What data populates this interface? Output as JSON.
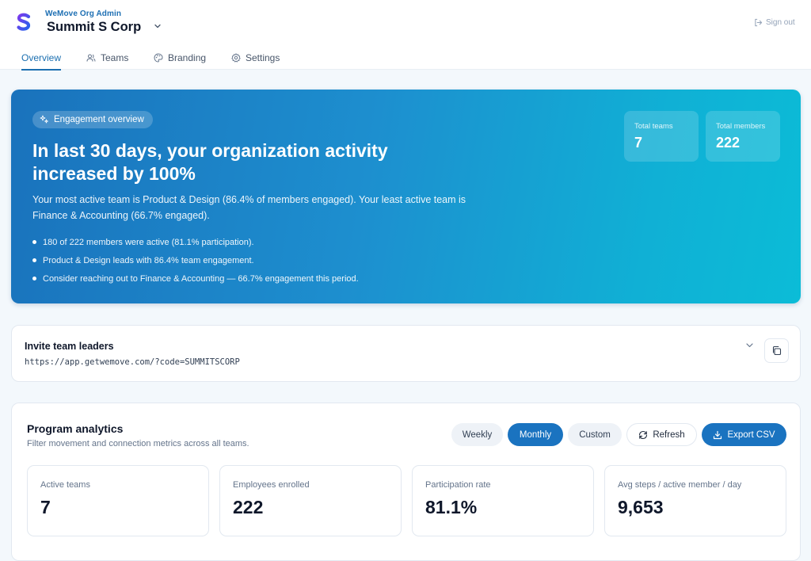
{
  "header": {
    "org_subtitle": "WeMove Org Admin",
    "org_name": "Summit S Corp",
    "sign_out": "Sign out",
    "brand_color": "#4f46e5"
  },
  "tabs": [
    {
      "label": "Overview",
      "icon": "none",
      "active": true
    },
    {
      "label": "Teams",
      "icon": "users-icon",
      "active": false
    },
    {
      "label": "Branding",
      "icon": "palette-icon",
      "active": false
    },
    {
      "label": "Settings",
      "icon": "gear-icon",
      "active": false
    }
  ],
  "hero": {
    "badge": "Engagement overview",
    "title": "In last 30 days, your organization activity increased by 100%",
    "description": "Your most active team is Product & Design (86.4% of members engaged). Your least active team is Finance & Accounting (66.7% engaged).",
    "bullets": [
      "180 of 222 members were active (81.1% participation).",
      "Product & Design leads with 86.4% team engagement.",
      "Consider reaching out to Finance & Accounting — 66.7% engagement this period."
    ],
    "stats": [
      {
        "label": "Total teams",
        "value": "7"
      },
      {
        "label": "Total members",
        "value": "222"
      }
    ]
  },
  "invite": {
    "title": "Invite team leaders",
    "link": "https://app.getwemove.com/?code=SUMMITSCORP"
  },
  "analytics": {
    "title": "Program analytics",
    "subtitle": "Filter movement and connection metrics across all teams.",
    "filters": [
      {
        "label": "Weekly",
        "active": false
      },
      {
        "label": "Monthly",
        "active": true
      },
      {
        "label": "Custom",
        "active": false
      }
    ],
    "refresh_label": "Refresh",
    "export_label": "Export CSV",
    "metrics": [
      {
        "label": "Active teams",
        "value": "7"
      },
      {
        "label": "Employees enrolled",
        "value": "222"
      },
      {
        "label": "Participation rate",
        "value": "81.1%"
      },
      {
        "label": "Avg steps / active member / day",
        "value": "9,653"
      }
    ]
  },
  "colors": {
    "accent": "#1a73c0",
    "hero_gradient_start": "#1a72bc",
    "hero_gradient_end": "#0bbcd7"
  }
}
